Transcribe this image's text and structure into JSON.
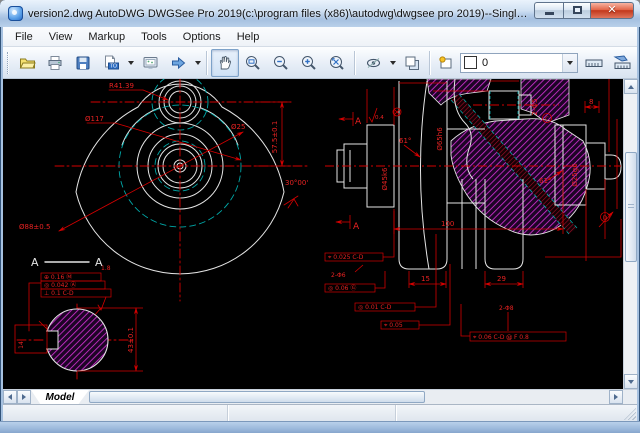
{
  "window": {
    "title": "version2.dwg AutoDWG DWGSee Pro 2019(c:\\program files (x86)\\autodwg\\dwgsee pro 2019)--Single user license"
  },
  "menu": {
    "items": [
      {
        "label": "File"
      },
      {
        "label": "View"
      },
      {
        "label": "Markup"
      },
      {
        "label": "Tools"
      },
      {
        "label": "Options"
      },
      {
        "label": "Help"
      }
    ]
  },
  "toolbar": {
    "layer": {
      "value": "0"
    }
  },
  "sheet_tabs": {
    "model": "Model"
  },
  "colors": {
    "canvas_bg": "#000000",
    "dimension_red": "#d40000",
    "outline_white": "#e4e4e4",
    "centerline_cyan": "#00a8a8",
    "hatch_magenta": "#d02fd0",
    "aero_blue": "#a6c1e0"
  },
  "drawing": {
    "labels": [
      {
        "t": "R41.39"
      },
      {
        "t": "Ø117"
      },
      {
        "t": "Ø25"
      },
      {
        "t": "57.5±0.1"
      },
      {
        "t": "30°00'"
      },
      {
        "t": "Ø88±0.5"
      },
      {
        "t": "A"
      },
      {
        "t": "A"
      },
      {
        "t": "1.8"
      },
      {
        "t": "⊕ 0.16 Ⓜ"
      },
      {
        "t": "◎ 0.042 Ⓐ"
      },
      {
        "t": "⊥ 0.1 C-D"
      },
      {
        "t": "14"
      },
      {
        "t": "43±0.1"
      },
      {
        "t": "A"
      },
      {
        "t": "A"
      },
      {
        "t": "Ø45k6"
      },
      {
        "t": "Ø65h6"
      },
      {
        "t": "0.4"
      },
      {
        "t": "61°"
      },
      {
        "t": "61°"
      },
      {
        "t": "2-Φ5"
      },
      {
        "t": "8"
      },
      {
        "t": "Ø25g6"
      },
      {
        "t": "100"
      },
      {
        "t": "15"
      },
      {
        "t": "29"
      },
      {
        "t": "⌖ 0.025 C-D"
      },
      {
        "t": "2-Φ6"
      },
      {
        "t": "◎ 0.06 Ⓖ"
      },
      {
        "t": "◎ 0.01 C-D"
      },
      {
        "t": "⌖ 0.05"
      },
      {
        "t": "2-Φ8"
      },
      {
        "t": "⌖ 0.06 C-D Ⓜ F 0.8"
      },
      {
        "t": "C"
      },
      {
        "t": "D"
      }
    ]
  }
}
